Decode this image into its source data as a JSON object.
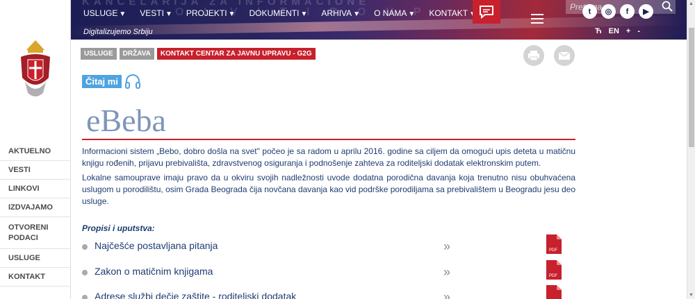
{
  "header": {
    "bg_text_1": "KANCELARIJA ZA INFORMACIONE",
    "bg_text_2": "O L V I T I R O U P",
    "tagline": "Digitalizujemo Srbiju",
    "menu": [
      {
        "label": "USLUGE"
      },
      {
        "label": "VESTI"
      },
      {
        "label": "PROJEKTI"
      },
      {
        "label": "DOKUMENTI"
      },
      {
        "label": "ARHIVA"
      },
      {
        "label": "O NAMA"
      },
      {
        "label": "KONTAKT"
      }
    ],
    "search_placeholder": "Pretraga",
    "languages": [
      "Ћ",
      "EN",
      "+",
      "-"
    ]
  },
  "sidebar": {
    "items": [
      "AKTUELNO",
      "VESTI",
      "LINKOVI",
      "IZDVAJAMO",
      "OTVORENI PODACI",
      "USLUGE",
      "KONTAKT"
    ]
  },
  "breadcrumbs": [
    "USLUGE",
    "DRŽAVA",
    "KONTAKT CENTAR ZA JAVNU UPRAVU - G2G"
  ],
  "read_label": "Čitaj mi",
  "page": {
    "title": "eBeba",
    "paragraph_1": "Informacioni sistem „Bebo, dobro došla na svet\" počeo je sa radom u aprilu 2016. godine sa ciljem da omogući upis deteta u matičnu knjigu rođenih, prijavu prebivališta, zdravstvenog osiguranja i podnošenje zahteva za roditeljski dodatak elektronskim putem.",
    "paragraph_2": "Lokalne samouprave imaju pravo da u okviru svojih nadležnosti uvode dodatna porodična davanja koja trenutno nisu obuhvaćena uslugom u porodilištu, osim Grada Beograda čija novčana davanja kao vid podrške porodiljama sa prebivalištem u Beogradu jesu deo usluge.",
    "section_title": "Propisi i uputstva:",
    "documents": [
      "Najčešće postavljana pitanja",
      "Zakon o matičnim knjigama",
      "Adrese službi dečje zaštite - roditeljski dodatak"
    ],
    "pdf_label": "PDF"
  },
  "colors": {
    "accent_red": "#c8202c",
    "text_blue": "#1e3c72",
    "title_blue": "#7d96b8",
    "read_blue": "#4fa3e0"
  }
}
